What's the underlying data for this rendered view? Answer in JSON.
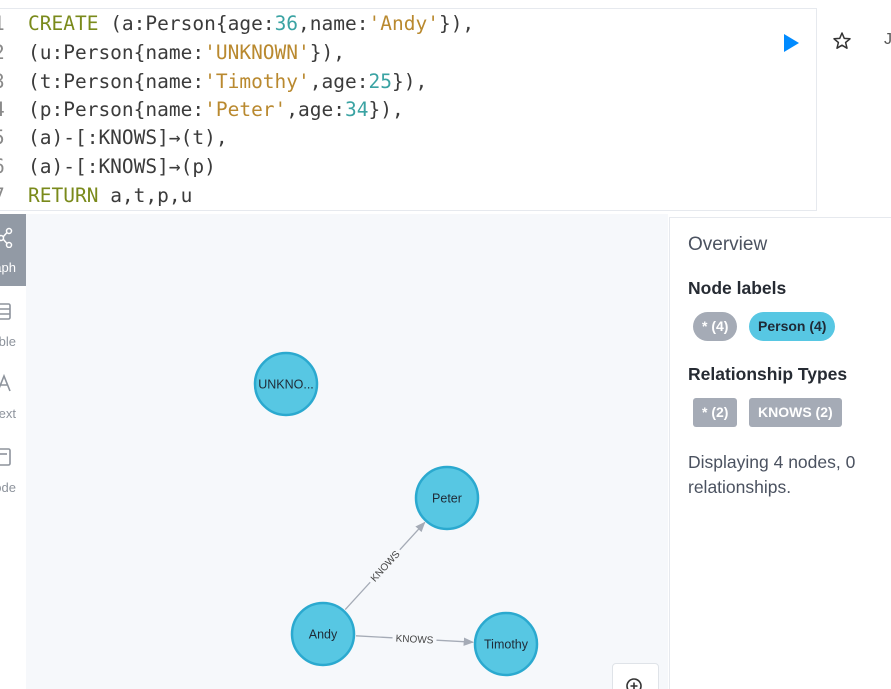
{
  "editor": {
    "lines": [
      {
        "n": "1",
        "parts": [
          [
            "kw",
            "CREATE"
          ],
          [
            "p",
            " (a:Person{age:"
          ],
          [
            "num",
            "36"
          ],
          [
            "p",
            ",name:"
          ],
          [
            "str",
            "'Andy'"
          ],
          [
            "p",
            "}),"
          ]
        ]
      },
      {
        "n": "2",
        "parts": [
          [
            "p",
            "(u:Person{name:"
          ],
          [
            "str",
            "'UNKNOWN'"
          ],
          [
            "p",
            "}),"
          ]
        ]
      },
      {
        "n": "3",
        "parts": [
          [
            "p",
            "(t:Person{name:"
          ],
          [
            "str",
            "'Timothy'"
          ],
          [
            "p",
            ",age:"
          ],
          [
            "num",
            "25"
          ],
          [
            "p",
            "}),"
          ]
        ]
      },
      {
        "n": "4",
        "parts": [
          [
            "p",
            "(p:Person{name:"
          ],
          [
            "str",
            "'Peter'"
          ],
          [
            "p",
            ",age:"
          ],
          [
            "num",
            "34"
          ],
          [
            "p",
            "}),"
          ]
        ]
      },
      {
        "n": "5",
        "parts": [
          [
            "p",
            "(a)-[:KNOWS]→(t),"
          ]
        ]
      },
      {
        "n": "6",
        "parts": [
          [
            "p",
            "(a)-[:KNOWS]→(p)"
          ]
        ]
      },
      {
        "n": "7",
        "parts": [
          [
            "kw",
            "RETURN"
          ],
          [
            "p",
            " a,t,p,u"
          ]
        ]
      }
    ],
    "more_label": "J"
  },
  "tabs": [
    {
      "label": "Graph",
      "icon": "graph-icon",
      "active": true
    },
    {
      "label": "Table",
      "icon": "table-icon",
      "active": false
    },
    {
      "label": "Text",
      "icon": "text-icon",
      "active": false
    },
    {
      "label": "Code",
      "icon": "code-icon",
      "active": false
    }
  ],
  "graph": {
    "nodes": [
      {
        "id": "u",
        "label": "UNKNO..."
      },
      {
        "id": "p",
        "label": "Peter"
      },
      {
        "id": "a",
        "label": "Andy"
      },
      {
        "id": "t",
        "label": "Timothy"
      }
    ],
    "relationships": [
      {
        "from": "a",
        "to": "p",
        "type": "KNOWS"
      },
      {
        "from": "a",
        "to": "t",
        "type": "KNOWS"
      }
    ],
    "node_color": "#57c7e3",
    "node_border": "#2ba9cf"
  },
  "overview": {
    "title": "Overview",
    "node_labels_heading": "Node labels",
    "node_labels": [
      {
        "text": "* (4)"
      },
      {
        "text": "Person (4)"
      }
    ],
    "rel_types_heading": "Relationship Types",
    "rel_types": [
      {
        "text": "* (2)"
      },
      {
        "text": "KNOWS (2)"
      }
    ],
    "summary": "Displaying 4 nodes, 0 relationships."
  },
  "colors": {
    "accent": "#018bff",
    "node_fill": "#57c7e3",
    "pill_grey": "#a5abb6"
  }
}
